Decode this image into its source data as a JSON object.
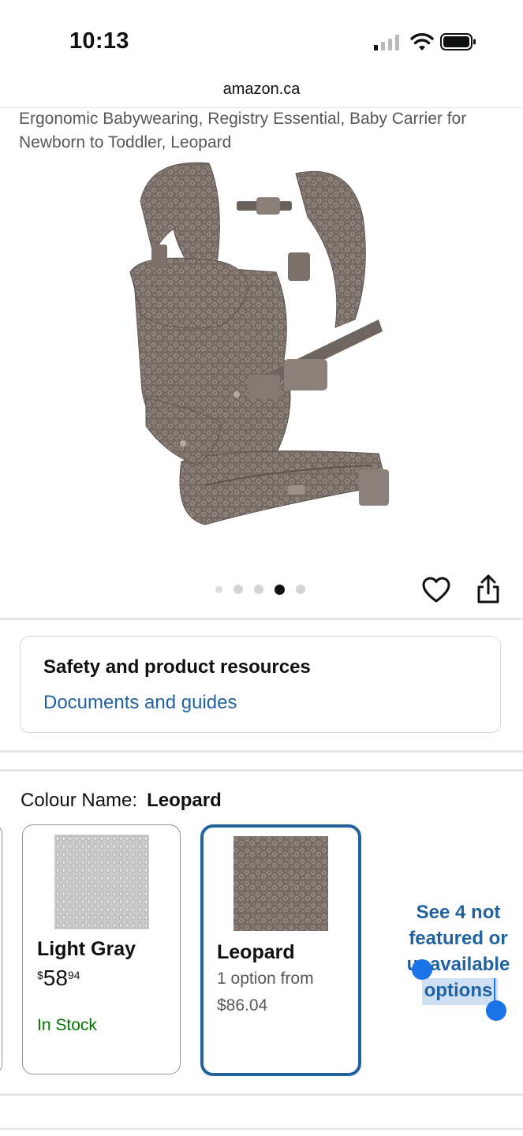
{
  "status_bar": {
    "time": "10:13"
  },
  "browser": {
    "url": "amazon.ca"
  },
  "product": {
    "title": "Ergonomic Babywearing, Registry Essential, Baby Carrier for Newborn to Toddler, Leopard",
    "image_icon": "baby-carrier-image",
    "carousel": {
      "total": 5,
      "active_index": 3
    }
  },
  "actions": {
    "wishlist_icon": "heart-icon",
    "share_icon": "share-icon"
  },
  "resources": {
    "title": "Safety and product resources",
    "link": "Documents and guides"
  },
  "colour": {
    "label": "Colour Name:",
    "selected": "Leopard",
    "swatches": [
      {
        "name": "Light Gray",
        "price_whole": "58",
        "price_fraction": "94",
        "currency_symbol": "$",
        "availability": "In Stock",
        "selected": false
      },
      {
        "name": "Leopard",
        "option_line1": "1 option from",
        "option_line2": "$86.04",
        "selected": true
      }
    ],
    "see_more": "See 4 not featured or unavailable options"
  },
  "colors": {
    "link_blue": "#2162a1",
    "selected_border": "#2162a1",
    "in_stock_green": "#007600",
    "selection_handle": "#1a73e8"
  }
}
